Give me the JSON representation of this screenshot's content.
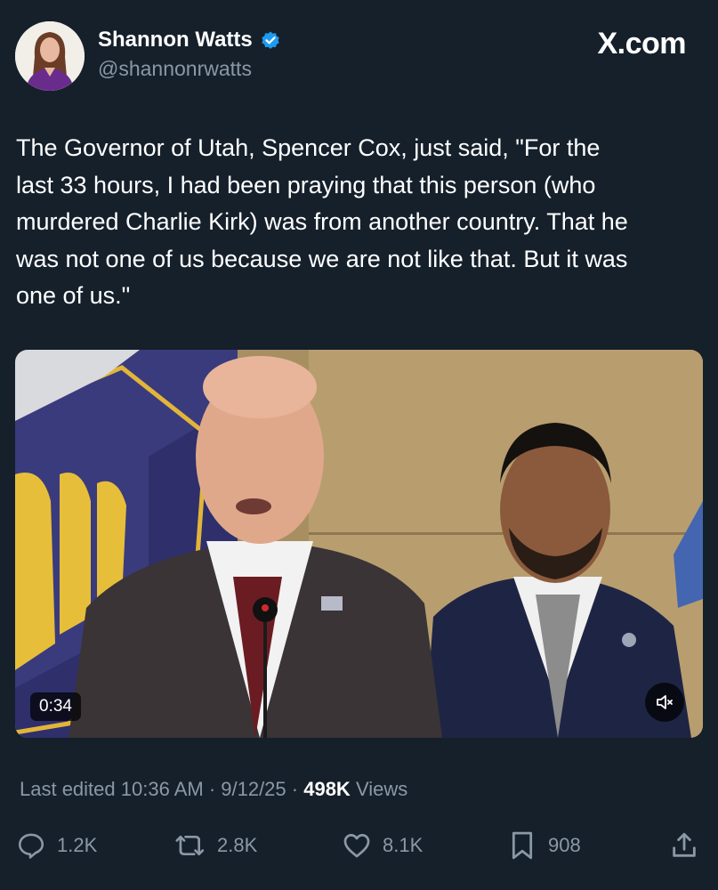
{
  "author": {
    "display_name": "Shannon Watts",
    "handle": "@shannonrwatts",
    "verified": true,
    "verified_color": "#1d9bf0"
  },
  "brand": "X.com",
  "tweet": {
    "text": "The Governor of Utah, Spencer Cox, just said, \"For the\nlast 33 hours, I had been praying that this person (who\nmurdered Charlie Kirk) was from another country. That he\nwas not one of us because we are not like that. But it was\none of us.\""
  },
  "media": {
    "type": "video",
    "duration": "0:34",
    "muted": true
  },
  "meta": {
    "edited_label": "Last edited 10:36 AM · 9/12/25 ·",
    "views_count": "498K",
    "views_label": "Views"
  },
  "actions": {
    "replies": "1.2K",
    "reposts": "2.8K",
    "likes": "8.1K",
    "bookmarks": "908"
  },
  "icons": [
    "verified-badge-icon",
    "reply-icon",
    "repost-icon",
    "like-icon",
    "bookmark-icon",
    "share-icon",
    "mute-icon"
  ]
}
